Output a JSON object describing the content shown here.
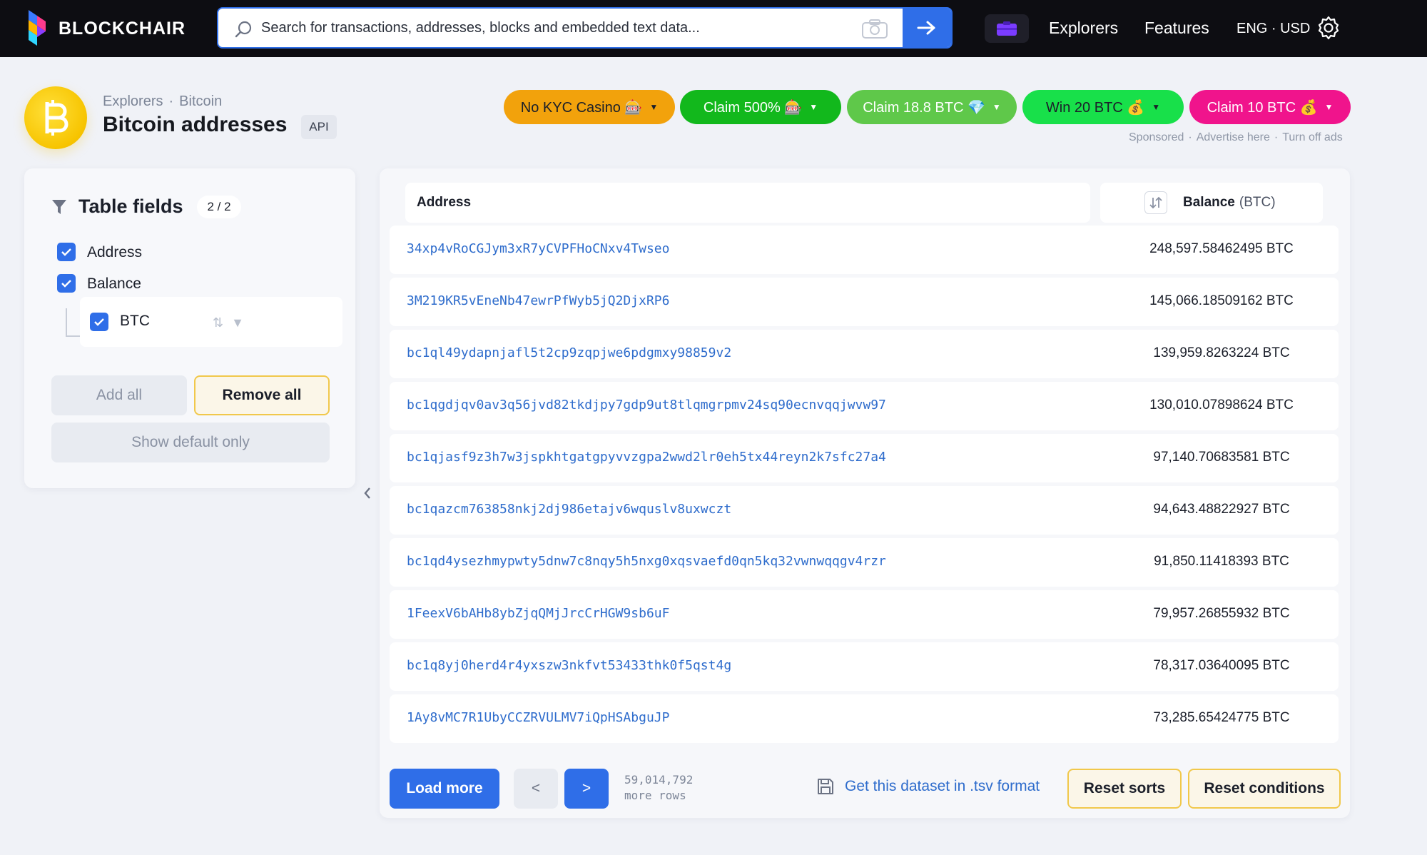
{
  "topbar": {
    "logo_text": "BLOCKCHAIR",
    "search_placeholder": "Search for transactions, addresses, blocks and embedded text data...",
    "nav": [
      "Explorers",
      "Features"
    ],
    "locale": "ENG · USD"
  },
  "header": {
    "breadcrumb": [
      "Explorers",
      "Bitcoin"
    ],
    "title": "Bitcoin addresses",
    "api_label": "API"
  },
  "ads": {
    "buttons": [
      {
        "label": "No KYC Casino 🎰",
        "bg": "#f2a20c",
        "fg": "#1b1f2a"
      },
      {
        "label": "Claim 500% 🎰",
        "bg": "#12b81c",
        "fg": "#ffffff"
      },
      {
        "label": "Claim 18.8 BTC 💎",
        "bg": "#5fc84a",
        "fg": "#ffffff"
      },
      {
        "label": "Win 20 BTC 💰",
        "bg": "#18e04a",
        "fg": "#1b1f2a"
      },
      {
        "label": "Claim 10 BTC 💰",
        "bg": "#f0148c",
        "fg": "#ffffff"
      }
    ],
    "sponsored": "Sponsored",
    "advertise": "Advertise here",
    "turn_off": "Turn off ads"
  },
  "sidebar": {
    "title": "Table fields",
    "count": "2 / 2",
    "fields": [
      "Address",
      "Balance"
    ],
    "subfield": "BTC",
    "add_all": "Add all",
    "remove_all": "Remove all",
    "show_default": "Show default only"
  },
  "table": {
    "col_address": "Address",
    "col_balance": "Balance",
    "col_balance_unit": "(BTC)",
    "rows": [
      {
        "address": "34xp4vRoCGJym3xR7yCVPFHoCNxv4Twseo",
        "balance": "248,597.58462495 BTC"
      },
      {
        "address": "3M219KR5vEneNb47ewrPfWyb5jQ2DjxRP6",
        "balance": "145,066.18509162 BTC"
      },
      {
        "address": "bc1ql49ydapnjafl5t2cp9zqpjwe6pdgmxy98859v2",
        "balance": "139,959.8263224 BTC"
      },
      {
        "address": "bc1qgdjqv0av3q56jvd82tkdjpy7gdp9ut8tlqmgrpmv24sq90ecnvqqjwvw97",
        "balance": "130,010.07898624 BTC"
      },
      {
        "address": "bc1qjasf9z3h7w3jspkhtgatgpyvvzgpa2wwd2lr0eh5tx44reyn2k7sfc27a4",
        "balance": "97,140.70683581 BTC"
      },
      {
        "address": "bc1qazcm763858nkj2dj986etajv6wquslv8uxwczt",
        "balance": "94,643.48822927 BTC"
      },
      {
        "address": "bc1qd4ysezhmypwty5dnw7c8nqy5h5nxg0xqsvaefd0qn5kq32vwnwqqgv4rzr",
        "balance": "91,850.11418393 BTC"
      },
      {
        "address": "1FeexV6bAHb8ybZjqQMjJrcCrHGW9sb6uF",
        "balance": "79,957.26855932 BTC"
      },
      {
        "address": "bc1q8yj0herd4r4yxszw3nkfvt53433thk0f5qst4g",
        "balance": "78,317.03640095 BTC"
      },
      {
        "address": "1Ay8vMC7R1UbyCCZRVULMV7iQpHSAbguJP",
        "balance": "73,285.65424775 BTC"
      }
    ]
  },
  "footer": {
    "load_more": "Load more",
    "prev": "<",
    "next": ">",
    "rows_count": "59,014,792",
    "rows_suffix": "more rows",
    "tsv_link": "Get this dataset in .tsv format",
    "reset_sorts": "Reset sorts",
    "reset_conditions": "Reset conditions"
  },
  "colors": {
    "accent": "#2f6ee8",
    "link": "#2e6ccc",
    "topbar": "#0d0d12",
    "bitcoin": "#f7c400"
  }
}
